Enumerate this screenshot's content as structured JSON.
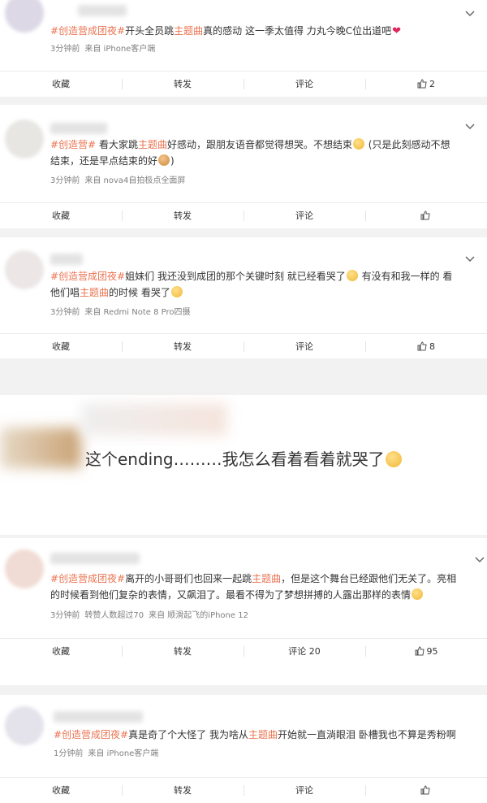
{
  "posts": [
    {
      "tag": "#创造营成团夜#",
      "text_before": "开头全员跳",
      "keyword": "主题曲",
      "text_after": "真的感动 这一季太值得 力丸今晚C位出道吧",
      "emoji": "heart",
      "time": "3分钟前",
      "source": "来自 iPhone客户端",
      "actions": {
        "collect": "收藏",
        "repost": "转发",
        "comment": "评论",
        "like": "2"
      }
    },
    {
      "tag": "#创造营#",
      "text_before": " 看大家跳",
      "keyword": "主题曲",
      "text_after": "好感动，跟朋友语音都觉得想哭。不想结束",
      "text_line2_a": " (只是此刻感动不想",
      "text_line2_b": "结束，还是早点结束的好",
      "text_line2_c": ")",
      "time": "3分钟前",
      "source": "来自 nova4自拍极点全面屏",
      "actions": {
        "collect": "收藏",
        "repost": "转发",
        "comment": "评论",
        "like": ""
      }
    },
    {
      "tag": "#创造营成团夜#",
      "text_before": "姐妹们 我还没到成团的那个关键时刻 就已经看哭了",
      "text_mid": " 有没有和我一样的 看",
      "text_line2_a": "他们唱",
      "keyword": "主题曲",
      "text_line2_b": "的时候 看哭了",
      "time": "3分钟前",
      "source": "来自 Redmi Note 8 Pro四摄",
      "actions": {
        "collect": "收藏",
        "repost": "转发",
        "comment": "评论",
        "like": "8"
      }
    },
    {
      "big_text": "这个ending………我怎么看着看着就哭了"
    },
    {
      "tag": "#创造营成团夜#",
      "text_before": "离开的小哥哥们也回来一起跳",
      "keyword": "主题曲",
      "text_after": "，但是这个舞台已经跟他们无关了。亮相",
      "text_line2": "的时候看到他们复杂的表情，又飙泪了。最看不得为了梦想拼搏的人露出那样的表情",
      "time": "3分钟前",
      "reposts_note": "转赞人数超过70",
      "source": "来自 顺滑起飞的iPhone 12",
      "actions": {
        "collect": "收藏",
        "repost": "转发",
        "comment": "评论 20",
        "like": "95"
      }
    },
    {
      "tag": "#创造营成团夜#",
      "text_before": "真是奇了个大怪了 我为啥从",
      "keyword": "主题曲",
      "text_after": "开始就一直淌眼泪 卧槽我也不算是秀粉啊",
      "time": "1分钟前",
      "source": "来自 iPhone客户端",
      "actions": {
        "collect": "收藏",
        "repost": "转发",
        "comment": "评论",
        "like": ""
      }
    }
  ],
  "colors": {
    "accent": "#eb7350",
    "meta": "#808080",
    "background": "#f2f2f2"
  }
}
